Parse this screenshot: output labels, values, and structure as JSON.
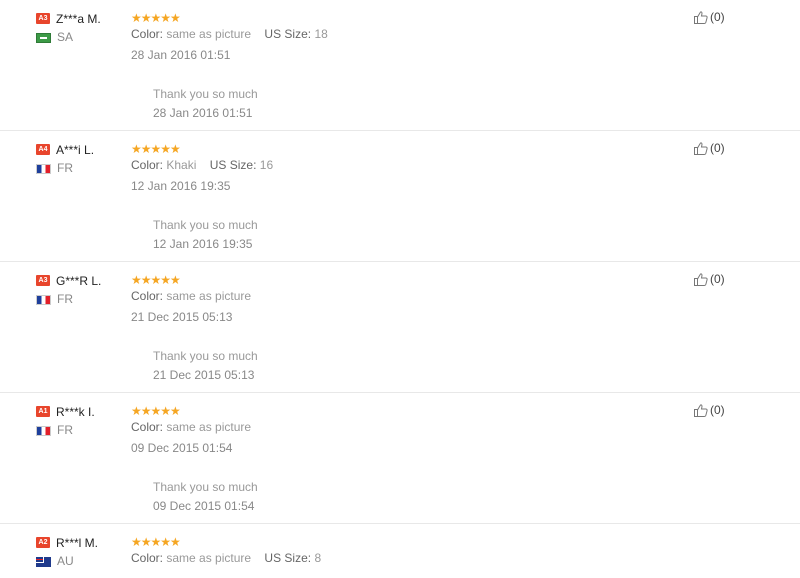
{
  "reviews": [
    {
      "level": "A3",
      "name": "Z***a M.",
      "flag": "sa",
      "country": "SA",
      "stars": "★★★★★",
      "attrs": [
        {
          "label": "Color:",
          "value": "same as picture"
        },
        {
          "label": "US Size:",
          "value": "18"
        }
      ],
      "date": "28 Jan 2016 01:51",
      "reply": "Thank you so much",
      "reply_date": "28 Jan 2016 01:51",
      "helpful": "(0)"
    },
    {
      "level": "A4",
      "name": "A***i L.",
      "flag": "fr",
      "country": "FR",
      "stars": "★★★★★",
      "attrs": [
        {
          "label": "Color:",
          "value": "Khaki"
        },
        {
          "label": "US Size:",
          "value": "16"
        }
      ],
      "date": "12 Jan 2016 19:35",
      "reply": "Thank you so much",
      "reply_date": "12 Jan 2016 19:35",
      "helpful": "(0)"
    },
    {
      "level": "A3",
      "name": "G***R L.",
      "flag": "fr",
      "country": "FR",
      "stars": "★★★★★",
      "attrs": [
        {
          "label": "Color:",
          "value": "same as picture"
        }
      ],
      "date": "21 Dec 2015 05:13",
      "reply": "Thank you so much",
      "reply_date": "21 Dec 2015 05:13",
      "helpful": "(0)"
    },
    {
      "level": "A1",
      "name": "R***k I.",
      "flag": "fr",
      "country": "FR",
      "stars": "★★★★★",
      "attrs": [
        {
          "label": "Color:",
          "value": "same as picture"
        }
      ],
      "date": "09 Dec 2015 01:54",
      "reply": "Thank you so much",
      "reply_date": "09 Dec 2015 01:54",
      "helpful": "(0)"
    },
    {
      "level": "A2",
      "name": "R***l M.",
      "flag": "au",
      "country": "AU",
      "stars": "★★★★★",
      "attrs": [
        {
          "label": "Color:",
          "value": "same as picture"
        },
        {
          "label": "US Size:",
          "value": "8"
        }
      ],
      "date": "",
      "reply": "",
      "reply_date": "",
      "helpful": ""
    }
  ],
  "colors": {
    "level_badge": "#e8452c",
    "stars": "#f5a623",
    "divider": "#e8e8e8"
  },
  "icons": {
    "helpful": "thumbs-up-icon",
    "star": "star-icon"
  }
}
